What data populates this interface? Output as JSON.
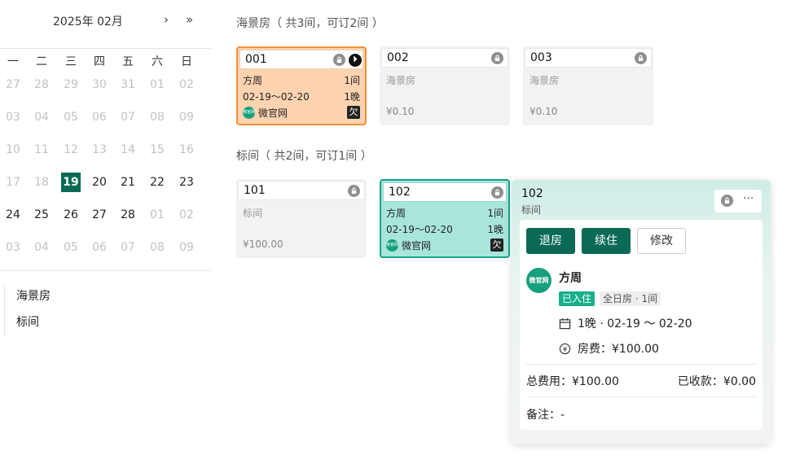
{
  "calendar": {
    "title": "2025年 02月",
    "next_label": "›",
    "next_year_label": "»",
    "weekdays": [
      "一",
      "二",
      "三",
      "四",
      "五",
      "六",
      "日"
    ],
    "weeks": [
      [
        "27",
        "28",
        "29",
        "30",
        "31",
        "01",
        "02"
      ],
      [
        "03",
        "04",
        "05",
        "06",
        "07",
        "08",
        "09"
      ],
      [
        "10",
        "11",
        "12",
        "13",
        "14",
        "15",
        "16"
      ],
      [
        "17",
        "18",
        "19",
        "20",
        "21",
        "22",
        "23"
      ],
      [
        "24",
        "25",
        "26",
        "27",
        "28",
        "01",
        "02"
      ],
      [
        "03",
        "04",
        "05",
        "06",
        "07",
        "08",
        "09"
      ]
    ],
    "today": "19"
  },
  "room_types": [
    "海景房",
    "标间"
  ],
  "sections": [
    {
      "title": "海景房（ 共3间，可订2间 ）",
      "rooms": [
        {
          "number": "001",
          "status": "occupied-orange",
          "guest": "方周",
          "count": "1间",
          "dates": "02-19～02-20",
          "nights": "1晚",
          "source": "微官网",
          "debt": "欠"
        },
        {
          "number": "002",
          "type": "海景房",
          "price": "¥0.10"
        },
        {
          "number": "003",
          "type": "海景房",
          "price": "¥0.10"
        }
      ]
    },
    {
      "title": "标间（ 共2间，可订1间 ）",
      "rooms": [
        {
          "number": "101",
          "type": "标间",
          "price": "¥100.00"
        },
        {
          "number": "102",
          "status": "occupied-teal",
          "guest": "方周",
          "count": "1间",
          "dates": "02-19～02-20",
          "nights": "1晚",
          "source": "微官网",
          "debt": "欠"
        }
      ]
    }
  ],
  "popover": {
    "room_number": "102",
    "room_type": "标间",
    "more_label": "···",
    "buttons": {
      "checkout": "退房",
      "extend": "续住",
      "edit": "修改"
    },
    "guest_logo_text": "微官网",
    "guest_name": "方周",
    "tag_status": "已入住",
    "tag_info": "全日房 · 1间",
    "stay": "1晚 · 02-19 ～ 02-20",
    "room_fee": "房费：¥100.00",
    "total_label": "总费用：¥100.00",
    "received_label": "已收款：¥0.00",
    "note": "备注：-"
  },
  "colors": {
    "primary": "#0a6a55",
    "occupied_orange_bg": "#fdd3b0",
    "occupied_orange_border": "#f0913a",
    "occupied_teal_bg": "#a8e6dc",
    "occupied_teal_border": "#17a48a",
    "source_green": "#16a07e"
  },
  "icons": {
    "lock": "lock-icon",
    "checkout": "checkout-icon",
    "calendar": "calendar-icon",
    "yen": "yen-icon",
    "more": "more-icon"
  }
}
